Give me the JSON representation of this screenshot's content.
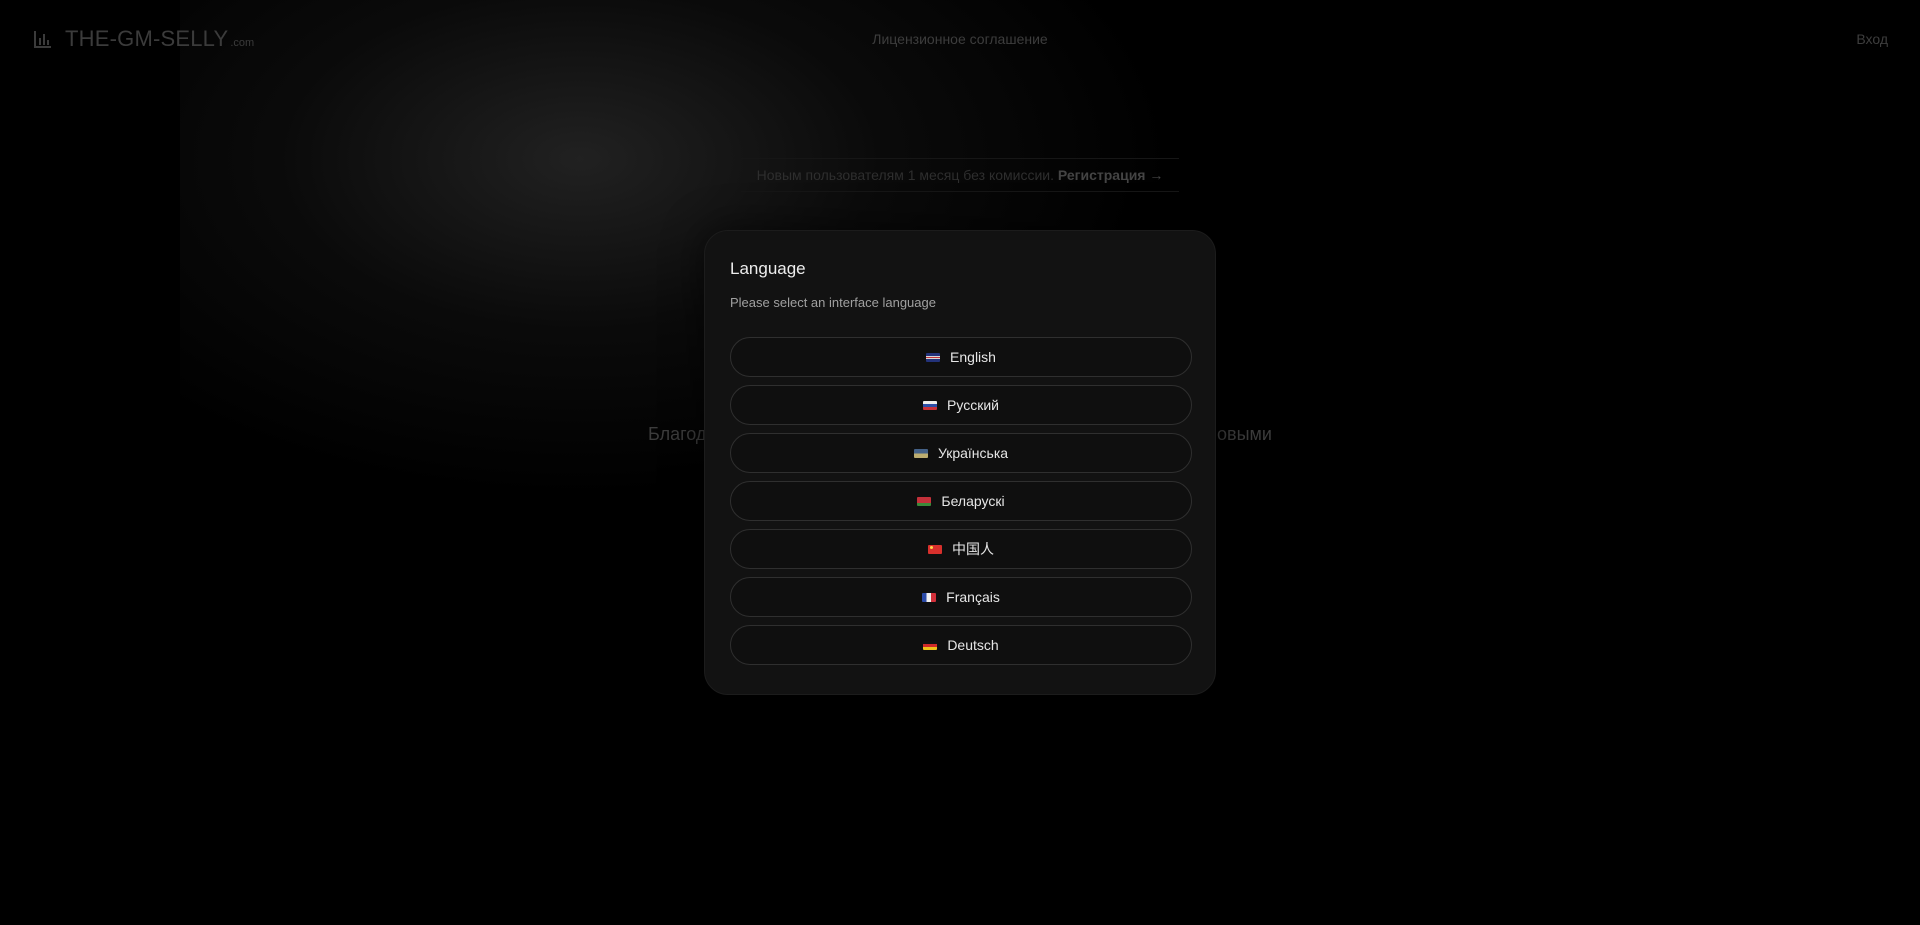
{
  "header": {
    "logo_text": "THE-GM-SELLY",
    "logo_suffix": ".com",
    "nav_license": "Лицензионное соглашение",
    "nav_login": "Вход"
  },
  "hero": {
    "promo_text": "Новым пользователям 1 месяц без комиссии.",
    "promo_link": "Регистрация →",
    "tagline_left": "Благод",
    "tagline_right": "овыми"
  },
  "modal": {
    "title": "Language",
    "subtitle": "Please select an interface language",
    "languages": [
      {
        "label": "English",
        "flag": "gb-flag-icon"
      },
      {
        "label": "Русский",
        "flag": "ru-flag-icon"
      },
      {
        "label": "Українська",
        "flag": "ua-flag-icon"
      },
      {
        "label": "Беларускі",
        "flag": "by-flag-icon"
      },
      {
        "label": "中国人",
        "flag": "cn-flag-icon"
      },
      {
        "label": "Français",
        "flag": "fr-flag-icon"
      },
      {
        "label": "Deutsch",
        "flag": "de-flag-icon"
      }
    ]
  },
  "colors": {
    "background": "#000000",
    "modal_background": "#121212",
    "button_border": "#2f2f2f",
    "text_primary": "#ededed",
    "text_muted": "#a0a0a0"
  }
}
